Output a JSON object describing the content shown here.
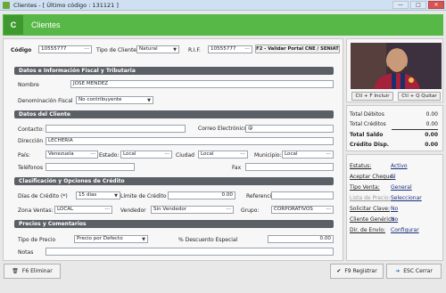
{
  "window": {
    "title": "Clientes - [ Último código : 131121 ]",
    "controls": {
      "minimize": "—",
      "maximize": "□",
      "close": "✕"
    }
  },
  "header": {
    "badge": "C",
    "title": "Clientes"
  },
  "top": {
    "codigo_label": "Código",
    "codigo_value": "10555777",
    "tipo_cliente_label": "Tipo de Cliente",
    "tipo_cliente_value": "Natural",
    "rif_label": "R.I.F.",
    "rif_value": "10555777",
    "validar_button": "F2 - Validar Portal CNE / SENIAT"
  },
  "sections": {
    "datos_info": "Datos e Información Fiscal y Tributaria",
    "datos_cliente": "Datos del Cliente",
    "clasificacion": "Clasificación y Opciones de Crédito",
    "precios": "Precios y Comentarios"
  },
  "fiscal": {
    "nombre_label": "Nombre",
    "nombre_value": "JOSE MENDEZ",
    "denominacion_label": "Denominación Fiscal",
    "denominacion_value": "No contribuyente"
  },
  "cliente": {
    "contacto_label": "Contacto:",
    "contacto_value": "",
    "correo_label": "Correo Electrónico",
    "correo_value": "@",
    "direccion_label": "Dirección",
    "direccion_value": "LECHERIA",
    "pais_label": "País:",
    "pais_value": "Venezuela",
    "estado_label": "Estado:",
    "estado_value": "Local",
    "ciudad_label": "Ciudad",
    "ciudad_value": "Local",
    "municipio_label": "Municipio:",
    "municipio_value": "Local",
    "telefonos_label": "Teléfonos",
    "telefonos_value": "",
    "fax_label": "Fax",
    "fax_value": ""
  },
  "credito": {
    "dias_label": "Días de Crédito (*)",
    "dias_value": "15 días",
    "limite_label": "Límite de Crédito",
    "limite_value": "0.00",
    "referencia_label": "Referencia",
    "referencia_value": "",
    "zona_label": "Zona Ventas:",
    "zona_value": "LOCAL",
    "vendedor_label": "Vendedor",
    "vendedor_value": "Sin Vendedor",
    "grupo_label": "Grupo:",
    "grupo_value": "CORPORATIVOS"
  },
  "precios": {
    "tipo_precio_label": "Tipo de Precio",
    "tipo_precio_value": "Precio por Defecto",
    "descuento_label": "% Descuento Especial",
    "descuento_value": "0.00",
    "notas_label": "Notas",
    "notas_value": ""
  },
  "photo": {
    "incluir_button": "Ctl + F Incluir",
    "quitar_button": "Ctl + Q Quitar"
  },
  "totals": {
    "debitos_label": "Total Débitos",
    "debitos_value": "0.00",
    "creditos_label": "Total Créditos",
    "creditos_value": "0.00",
    "saldo_label": "Total Saldo",
    "saldo_value": "0.00",
    "credito_disp_label": "Crédito Disp.",
    "credito_disp_value": "0.00"
  },
  "status": [
    {
      "label": "Estatus:",
      "value": "Activo",
      "disabled": false
    },
    {
      "label": "Aceptar Cheque:",
      "value": "Sí",
      "disabled": false
    },
    {
      "label": "Tipo Venta:",
      "value": "General",
      "disabled": false
    },
    {
      "label": "Lista de Precio:",
      "value": "Seleccionar",
      "disabled": true
    },
    {
      "label": "Solicitar Clave:",
      "value": "No",
      "disabled": false
    },
    {
      "label": "Cliente Genérico",
      "value": "No",
      "disabled": false
    },
    {
      "label": "Dir. de Envío:",
      "value": "Configurar",
      "disabled": false
    }
  ],
  "footer": {
    "eliminar": "F6  Eliminar",
    "registrar": "F9  Registrar",
    "cerrar": "ESC  Cerrar"
  },
  "colors": {
    "accent": "#58b847",
    "section": "#5b5f66"
  }
}
